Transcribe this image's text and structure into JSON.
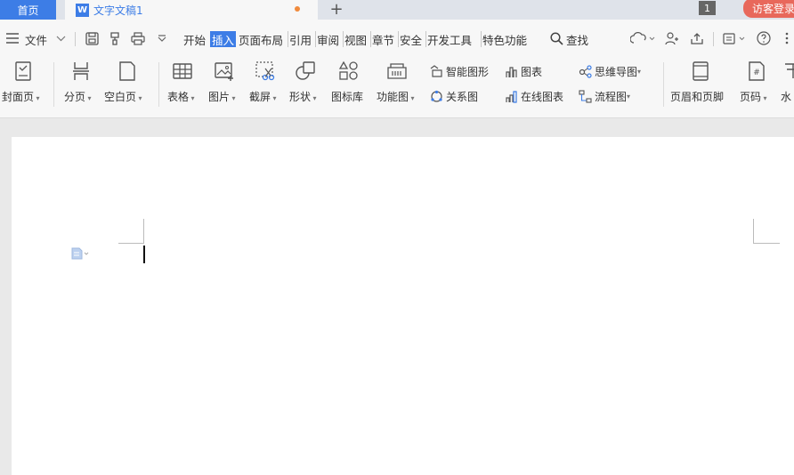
{
  "tabs": {
    "home": "首页",
    "doc_icon_letter": "W",
    "doc_title": "文字文稿1",
    "add": "+",
    "badge": "1",
    "login": "访客登录"
  },
  "menu": {
    "file": "文件",
    "items": [
      "开始",
      "插入",
      "页面布局",
      "引用",
      "审阅",
      "视图",
      "章节",
      "安全",
      "开发工具",
      "特色功能"
    ],
    "search": "查找"
  },
  "ribbon": {
    "cover_page": "封面页",
    "page_break": "分页",
    "blank_page": "空白页",
    "table": "表格",
    "picture": "图片",
    "screenshot": "截屏",
    "shape": "形状",
    "icon_library": "图标库",
    "function_chart": "功能图",
    "smart_graphic": "智能图形",
    "chart": "图表",
    "mind_map": "思维导图",
    "relation_chart": "关系图",
    "online_chart": "在线图表",
    "flowchart": "流程图",
    "header_footer": "页眉和页脚",
    "page_number": "页码",
    "watermark": "水"
  },
  "colors": {
    "accent": "#3d7de6",
    "login_bg": "#e8685b",
    "modified_dot": "#f08a3c"
  }
}
